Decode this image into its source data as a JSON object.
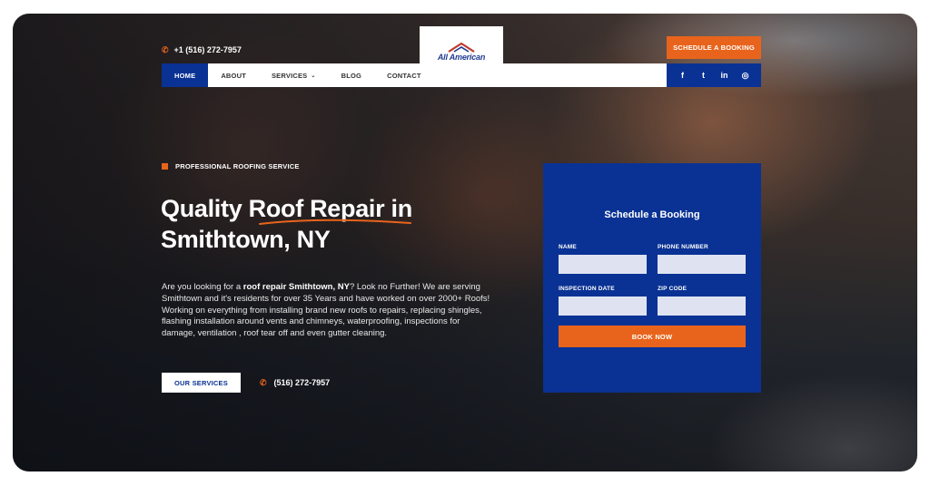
{
  "header": {
    "phone": "+1 (516) 272-7957",
    "logo_text": "All American",
    "cta_label": "SCHEDULE A BOOKING"
  },
  "nav": {
    "items": [
      {
        "label": "HOME",
        "active": true
      },
      {
        "label": "ABOUT",
        "active": false
      },
      {
        "label": "SERVICES",
        "active": false,
        "has_dropdown": true
      },
      {
        "label": "BLOG",
        "active": false
      },
      {
        "label": "CONTACT",
        "active": false
      }
    ]
  },
  "social": {
    "icons": [
      "facebook-icon",
      "twitter-icon",
      "linkedin-icon",
      "instagram-icon"
    ],
    "glyphs": [
      "f",
      "t",
      "in",
      "◎"
    ]
  },
  "hero": {
    "eyebrow": "PROFESSIONAL ROOFING SERVICE",
    "title_line1": "Quality Roof Repair in",
    "title_line2": "Smithtown, NY",
    "para_prefix": "Are you looking for a ",
    "para_bold": "roof repair Smithtown, NY",
    "para_suffix": "? Look no Further! We are serving Smithtown and it's residents for over 35 Years and have worked on over 2000+ Roofs! Working on everything from installing brand new roofs to repairs, replacing shingles, flashing installation around vents and chimneys, waterproofing, inspections for damage, ventilation , roof tear off and even gutter cleaning.",
    "services_button": "OUR SERVICES",
    "phone": "(516) 272-7957"
  },
  "form": {
    "title": "Schedule a Booking",
    "name_label": "NAME",
    "phone_label": "PHONE NUMBER",
    "date_label": "INSPECTION DATE",
    "zip_label": "ZIP CODE",
    "submit_label": "BOOK NOW"
  },
  "colors": {
    "brand_blue": "#0a3294",
    "accent_orange": "#e8641c"
  }
}
